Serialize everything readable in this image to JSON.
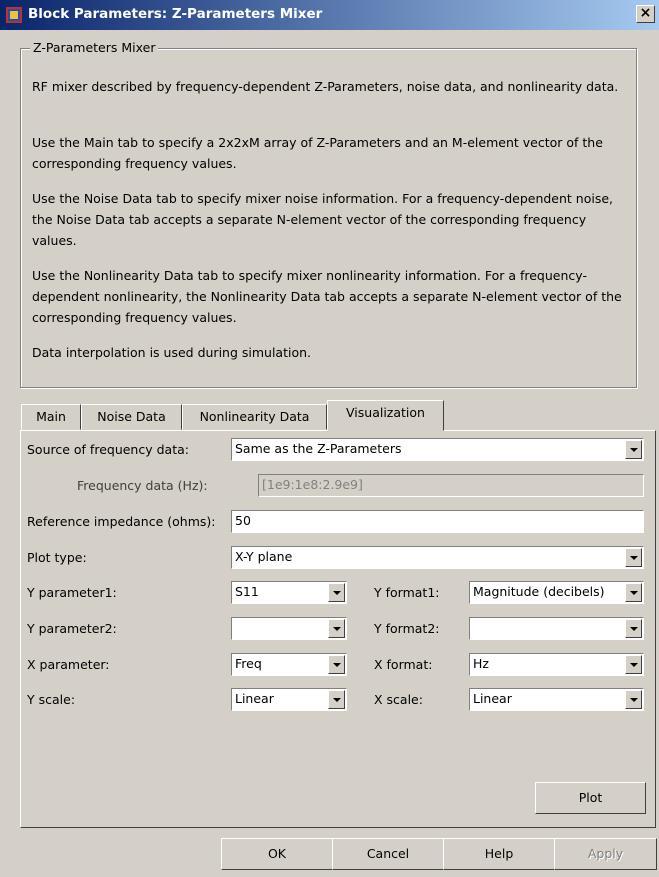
{
  "window": {
    "title": "Block Parameters: Z-Parameters Mixer",
    "close_glyph": "×"
  },
  "description": {
    "group_title": "Z-Parameters Mixer",
    "paragraphs": [
      "RF mixer described by frequency-dependent Z-Parameters, noise data, and nonlinearity data.",
      "Use the Main tab to specify a 2x2xM array of Z-Parameters and an M-element vector of the corresponding frequency values.",
      "Use the Noise Data tab to specify mixer noise information. For a frequency-dependent noise, the Noise Data tab accepts a separate N-element vector of the corresponding frequency values.",
      "Use the Nonlinearity Data tab to specify mixer nonlinearity information. For a frequency-dependent nonlinearity, the Nonlinearity Data tab accepts a separate N-element vector of the corresponding frequency values.",
      "Data interpolation is used during simulation."
    ]
  },
  "tabs": [
    "Main",
    "Noise Data",
    "Nonlinearity Data",
    "Visualization"
  ],
  "active_tab": "Visualization",
  "visualization": {
    "source_label": "Source of frequency data:",
    "source_value": "Same as the Z-Parameters",
    "freq_label": "Frequency data (Hz):",
    "freq_value": "[1e9:1e8:2.9e9]",
    "ref_label": "Reference impedance (ohms):",
    "ref_value": "50",
    "plot_type_label": "Plot type:",
    "plot_type_value": "X-Y plane",
    "yparam1_label": "Y parameter1:",
    "yparam1_value": "S11",
    "yformat1_label": "Y format1:",
    "yformat1_value": "Magnitude (decibels)",
    "yparam2_label": "Y parameter2:",
    "yparam2_value": "",
    "yformat2_label": "Y format2:",
    "yformat2_value": "",
    "xparam_label": "X parameter:",
    "xparam_value": "Freq",
    "xformat_label": "X format:",
    "xformat_value": "Hz",
    "yscale_label": "Y scale:",
    "yscale_value": "Linear",
    "xscale_label": "X scale:",
    "xscale_value": "Linear",
    "plot_button": "Plot"
  },
  "buttons": {
    "ok": "OK",
    "cancel": "Cancel",
    "help": "Help",
    "apply": "Apply"
  },
  "icons": {
    "title_icon": "simulink-block-icon",
    "close": "close-icon"
  }
}
